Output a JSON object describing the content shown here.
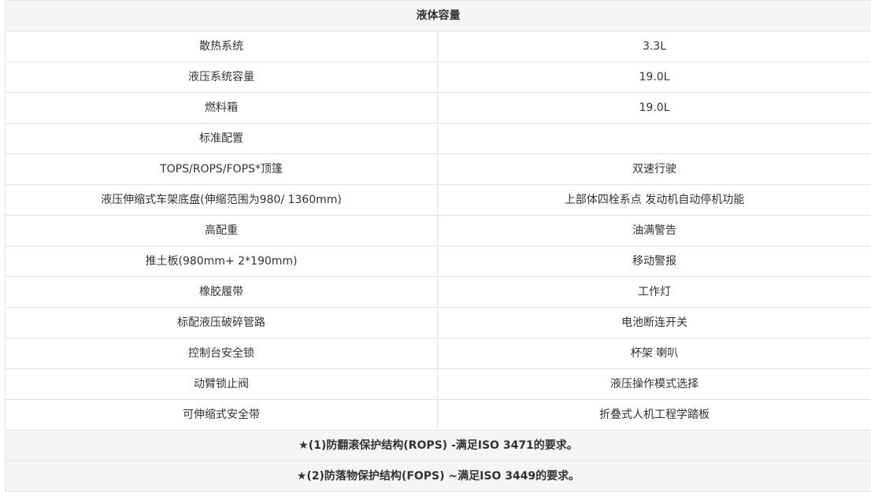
{
  "table": {
    "header": "液体容量",
    "rows": [
      [
        "散热系统",
        "3.3L"
      ],
      [
        "液压系统容量",
        "19.0L"
      ],
      [
        "燃料箱",
        "19.0L"
      ],
      [
        "标准配置",
        ""
      ],
      [
        "TOPS/ROPS/FOPS*顶篷",
        "双速行驶"
      ],
      [
        "液压伸缩式车架底盘(伸缩范围为980/ 1360mm)",
        "上部体四栓系点  发动机自动停机功能"
      ],
      [
        "高配重",
        "油满警告"
      ],
      [
        "推土板(980mm+ 2*190mm)",
        "移动警报"
      ],
      [
        "橡胶履带",
        "工作灯"
      ],
      [
        "标配液压破碎管路",
        "电池断连开关"
      ],
      [
        "控制台安全锁",
        "杯架  喇叭"
      ],
      [
        "动臂锁止阀",
        "液压操作模式选择"
      ],
      [
        "可伸缩式安全带",
        "折叠式人机工程学踏板"
      ]
    ],
    "notes": [
      "★(1)防翻滚保护结构(ROPS) -满足ISO 3471的要求。",
      "★(2)防落物保护结构(FOPS) ~满足ISO 3449的要求。"
    ]
  }
}
